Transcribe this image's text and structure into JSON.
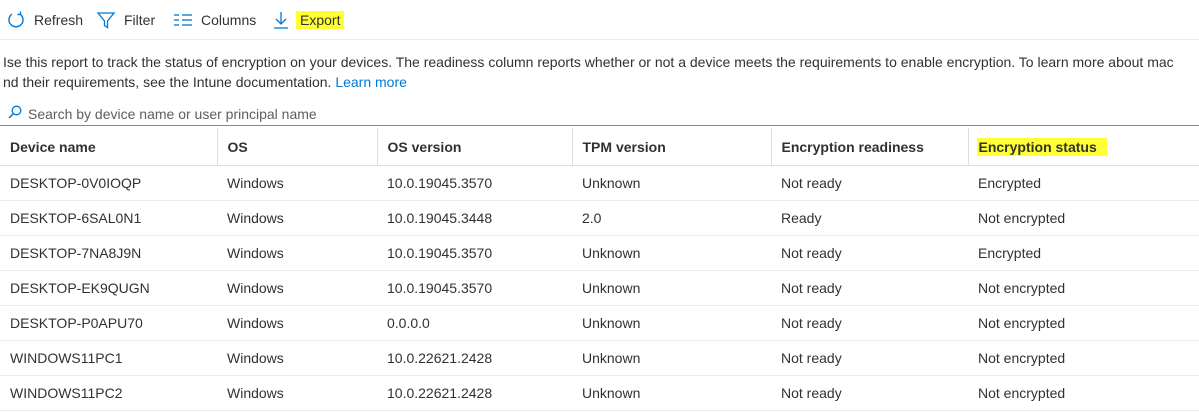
{
  "toolbar": {
    "refresh": "Refresh",
    "filter": "Filter",
    "columns": "Columns",
    "export": "Export",
    "highlight_color": "#ffff33",
    "icon_color": "#0078d4"
  },
  "description": {
    "line1": "Ise this report to track the status of encryption on your devices. The readiness column reports whether or not a device meets the requirements to enable encryption. To learn more about mac",
    "line2": "nd their requirements, see the Intune documentation.",
    "link": "Learn more"
  },
  "search": {
    "placeholder": "Search by device name or user principal name"
  },
  "table": {
    "columns": [
      "Device name",
      "OS",
      "OS version",
      "TPM version",
      "Encryption readiness",
      "Encryption status"
    ],
    "rows": [
      [
        "DESKTOP-0V0IOQP",
        "Windows",
        "10.0.19045.3570",
        "Unknown",
        "Not ready",
        "Encrypted"
      ],
      [
        "DESKTOP-6SAL0N1",
        "Windows",
        "10.0.19045.3448",
        "2.0",
        "Ready",
        "Not encrypted"
      ],
      [
        "DESKTOP-7NA8J9N",
        "Windows",
        "10.0.19045.3570",
        "Unknown",
        "Not ready",
        "Encrypted"
      ],
      [
        "DESKTOP-EK9QUGN",
        "Windows",
        "10.0.19045.3570",
        "Unknown",
        "Not ready",
        "Not encrypted"
      ],
      [
        "DESKTOP-P0APU70",
        "Windows",
        "0.0.0.0",
        "Unknown",
        "Not ready",
        "Not encrypted"
      ],
      [
        "WINDOWS11PC1",
        "Windows",
        "10.0.22621.2428",
        "Unknown",
        "Not ready",
        "Not encrypted"
      ],
      [
        "WINDOWS11PC2",
        "Windows",
        "10.0.22621.2428",
        "Unknown",
        "Not ready",
        "Not encrypted"
      ]
    ]
  }
}
